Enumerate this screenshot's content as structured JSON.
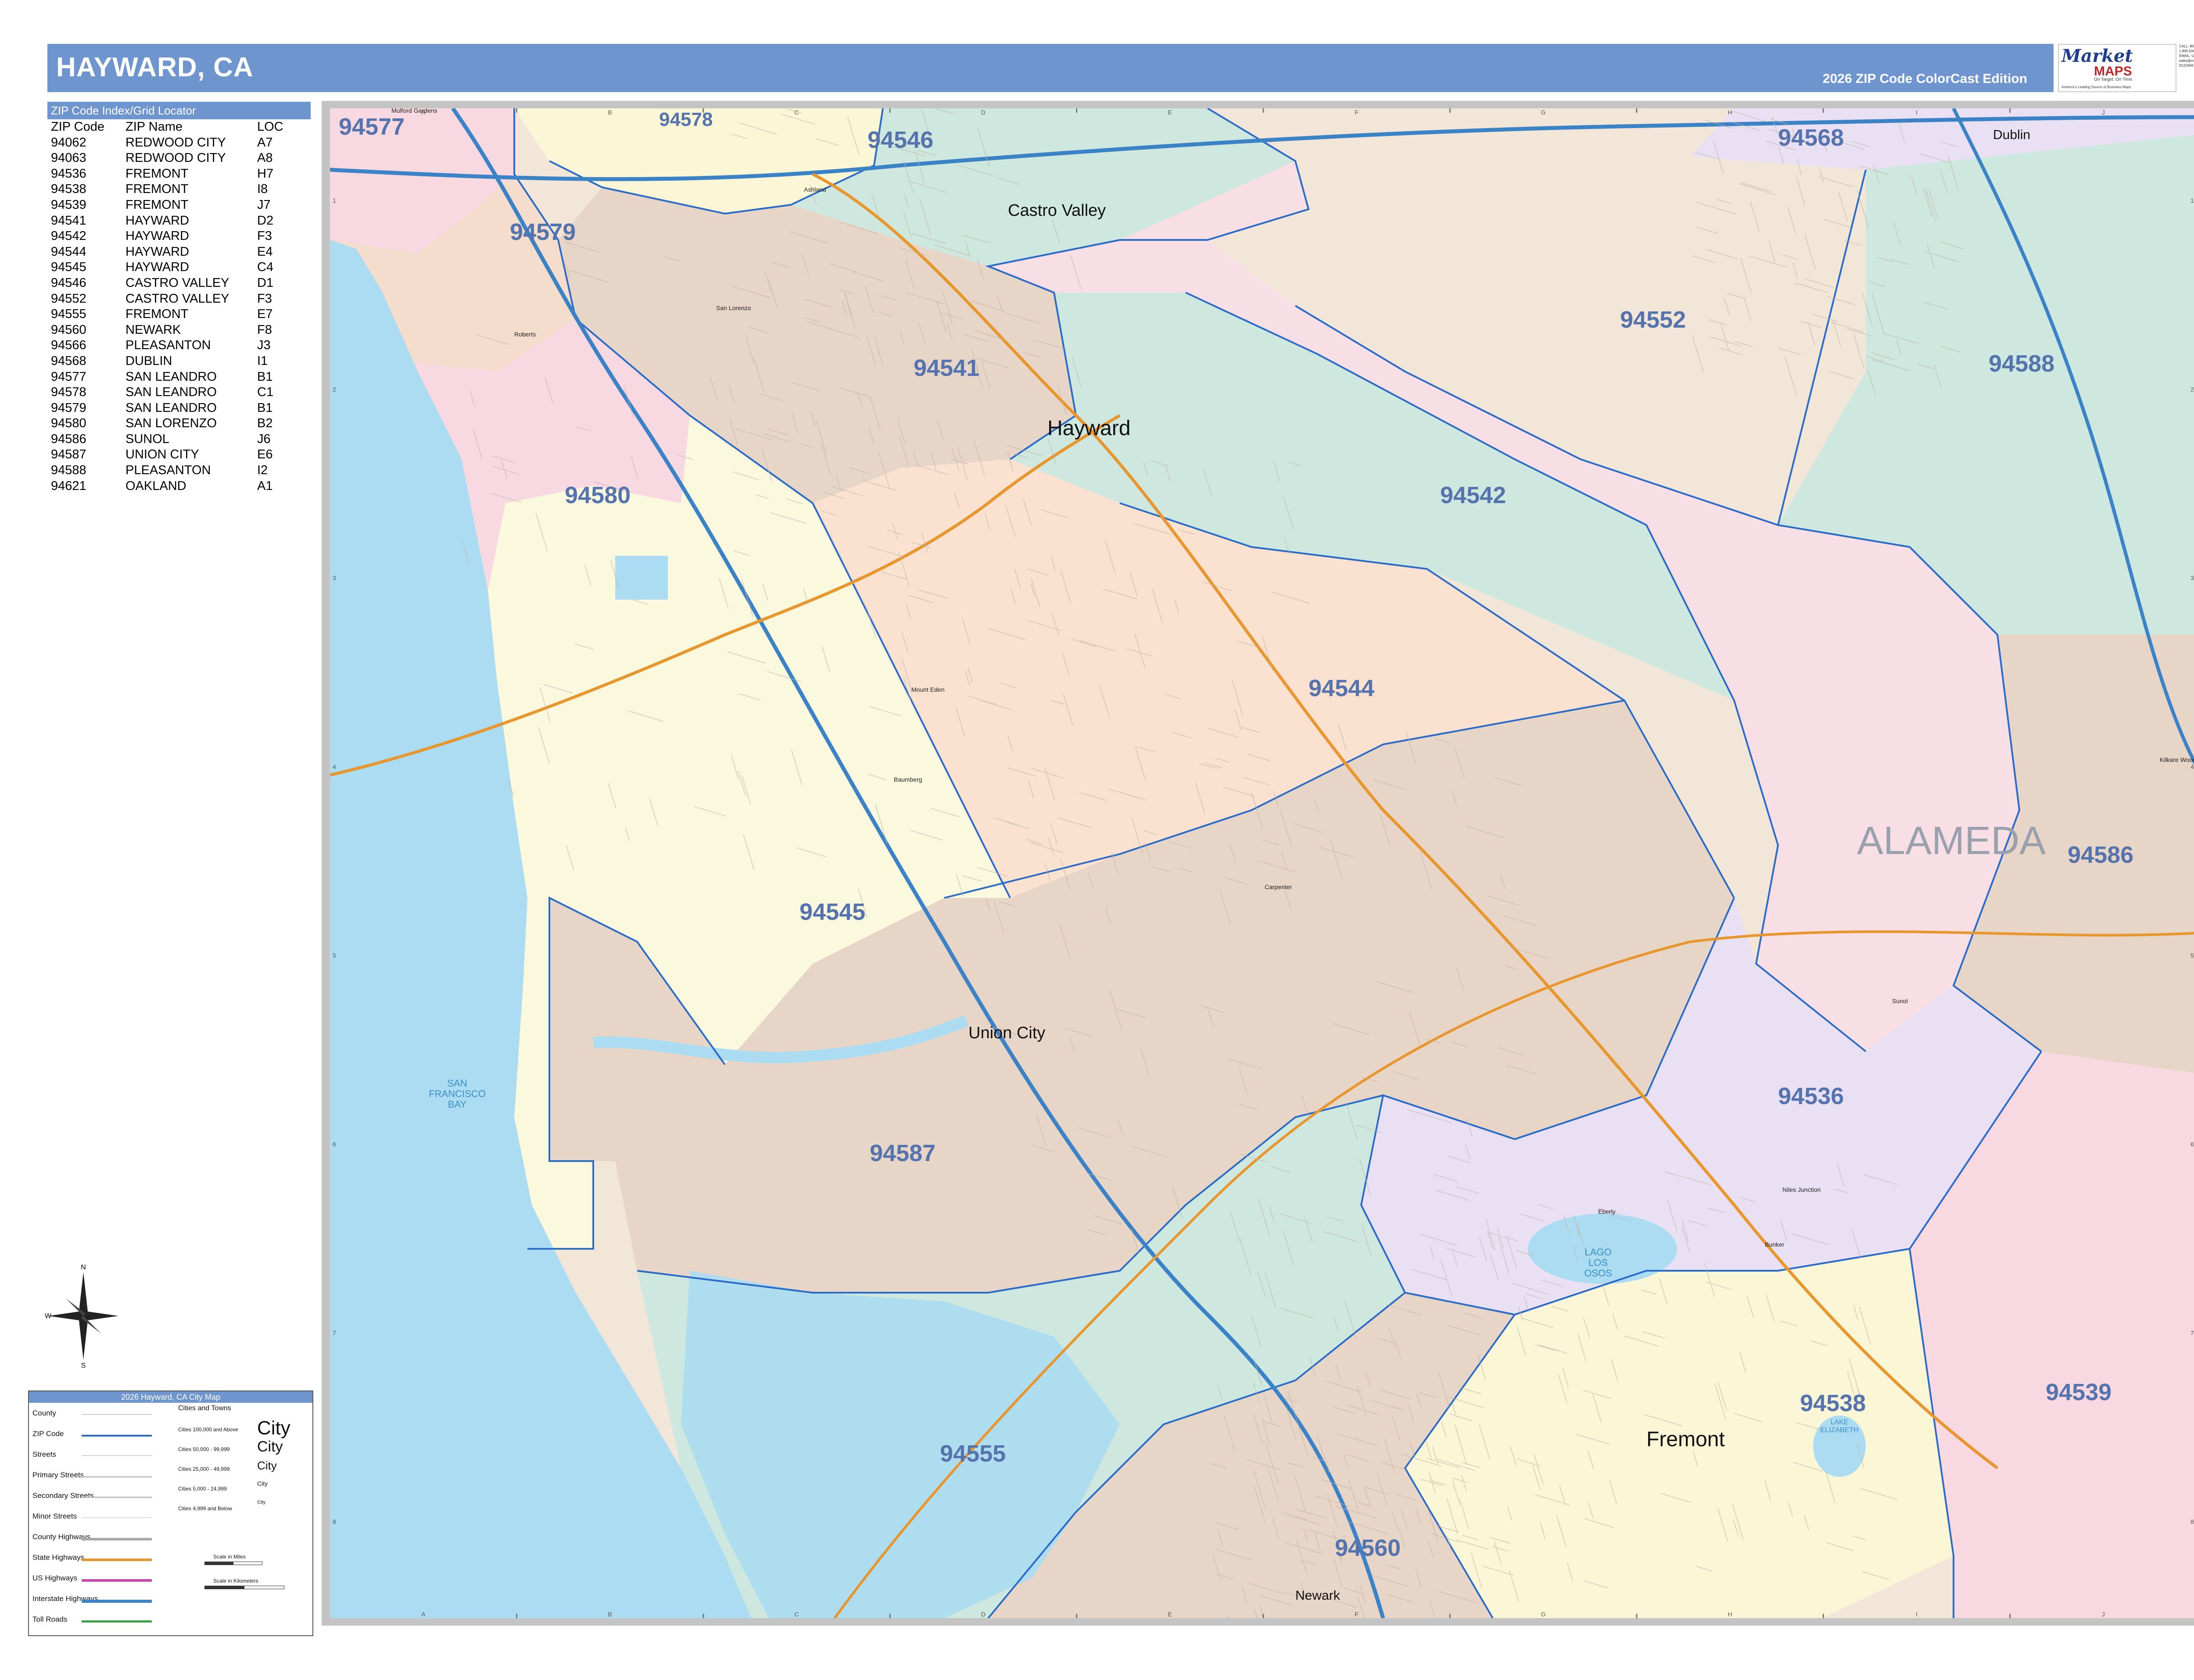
{
  "header": {
    "title": "HAYWARD, CA",
    "edition": "2026 ZIP Code ColorCast Edition"
  },
  "logo": {
    "brand": "Market",
    "brand2": "MAPS",
    "tagline": "On Target. On Time.",
    "subtitle": "America's Leading Source of Business Maps",
    "contact": [
      "CALL: 800.793.1902",
      "1.800.634.4321",
      "EMAIL: US AT",
      "sales@marketmaps.com",
      "D123456"
    ]
  },
  "index": {
    "title": "ZIP Code Index/Grid Locator",
    "columns": [
      "ZIP Code",
      "ZIP Name",
      "LOC"
    ],
    "rows": [
      [
        "94062",
        "REDWOOD CITY",
        "A7"
      ],
      [
        "94063",
        "REDWOOD CITY",
        "A8"
      ],
      [
        "94536",
        "FREMONT",
        "H7"
      ],
      [
        "94538",
        "FREMONT",
        "I8"
      ],
      [
        "94539",
        "FREMONT",
        "J7"
      ],
      [
        "94541",
        "HAYWARD",
        "D2"
      ],
      [
        "94542",
        "HAYWARD",
        "F3"
      ],
      [
        "94544",
        "HAYWARD",
        "E4"
      ],
      [
        "94545",
        "HAYWARD",
        "C4"
      ],
      [
        "94546",
        "CASTRO VALLEY",
        "D1"
      ],
      [
        "94552",
        "CASTRO VALLEY",
        "F3"
      ],
      [
        "94555",
        "FREMONT",
        "E7"
      ],
      [
        "94560",
        "NEWARK",
        "F8"
      ],
      [
        "94566",
        "PLEASANTON",
        "J3"
      ],
      [
        "94568",
        "DUBLIN",
        "I1"
      ],
      [
        "94577",
        "SAN LEANDRO",
        "B1"
      ],
      [
        "94578",
        "SAN LEANDRO",
        "C1"
      ],
      [
        "94579",
        "SAN LEANDRO",
        "B1"
      ],
      [
        "94580",
        "SAN LORENZO",
        "B2"
      ],
      [
        "94586",
        "SUNOL",
        "J6"
      ],
      [
        "94587",
        "UNION CITY",
        "E6"
      ],
      [
        "94588",
        "PLEASANTON",
        "I2"
      ],
      [
        "94621",
        "OAKLAND",
        "A1"
      ]
    ]
  },
  "map": {
    "zip_labels": [
      "94577",
      "94578",
      "94546",
      "94568",
      "94579",
      "94541",
      "94580",
      "94552",
      "94588",
      "94542",
      "94544",
      "94545",
      "94586",
      "94587",
      "94536",
      "94555",
      "94538",
      "94539",
      "94560"
    ],
    "cities": [
      "Castro Valley",
      "Hayward",
      "Union City",
      "Fremont",
      "Dublin",
      "Newark"
    ],
    "small_places": [
      "Ashland",
      "San Lorenzo",
      "Mount Eden",
      "Baumberg",
      "Carpenter",
      "Sunol",
      "Niles Junction",
      "Eberly",
      "Kilkare Woods",
      "Mulford Gardens",
      "Roberts",
      "Bunker"
    ],
    "county_label": "ALAMEDA",
    "water_labels": [
      "SAN FRANCISCO BAY",
      "LAGO LOS OSOS",
      "LAKE ELIZABETH"
    ],
    "grid_columns": [
      "A",
      "B",
      "C",
      "D",
      "E",
      "F",
      "G",
      "H",
      "I",
      "J"
    ],
    "grid_rows": [
      "1",
      "2",
      "3",
      "4",
      "5",
      "6",
      "7",
      "8"
    ],
    "colors": {
      "water": "#abdcf2",
      "zip_boundary": "#2b6cc8",
      "interstate": "#3b82c6",
      "state_highway": "#e8962e",
      "label": "#5573ad"
    }
  },
  "compass": {
    "n": "N",
    "s": "S",
    "e": "E",
    "w": "W"
  },
  "legend": {
    "title": "2026 Hayward, CA City Map",
    "items": [
      "County",
      "ZIP Code",
      "Streets",
      "Primary Streets",
      "Secondary Streets",
      "Minor Streets",
      "County Highways",
      "State Highways",
      "US Highways",
      "Interstate Highways",
      "Toll Roads"
    ],
    "cities_title": "Cities and Towns",
    "city_tiers": [
      {
        "range": "Cities 100,000 and Above",
        "sample": "City"
      },
      {
        "range": "Cities 50,000 - 99,999",
        "sample": "City"
      },
      {
        "range": "Cities 25,000 - 49,999",
        "sample": "City"
      },
      {
        "range": "Cities 5,000 - 24,999",
        "sample": "City"
      },
      {
        "range": "Cities 4,999 and Below",
        "sample": "City"
      }
    ],
    "scale_miles": "Scale in Miles",
    "scale_km": "Scale in Kilometers"
  }
}
